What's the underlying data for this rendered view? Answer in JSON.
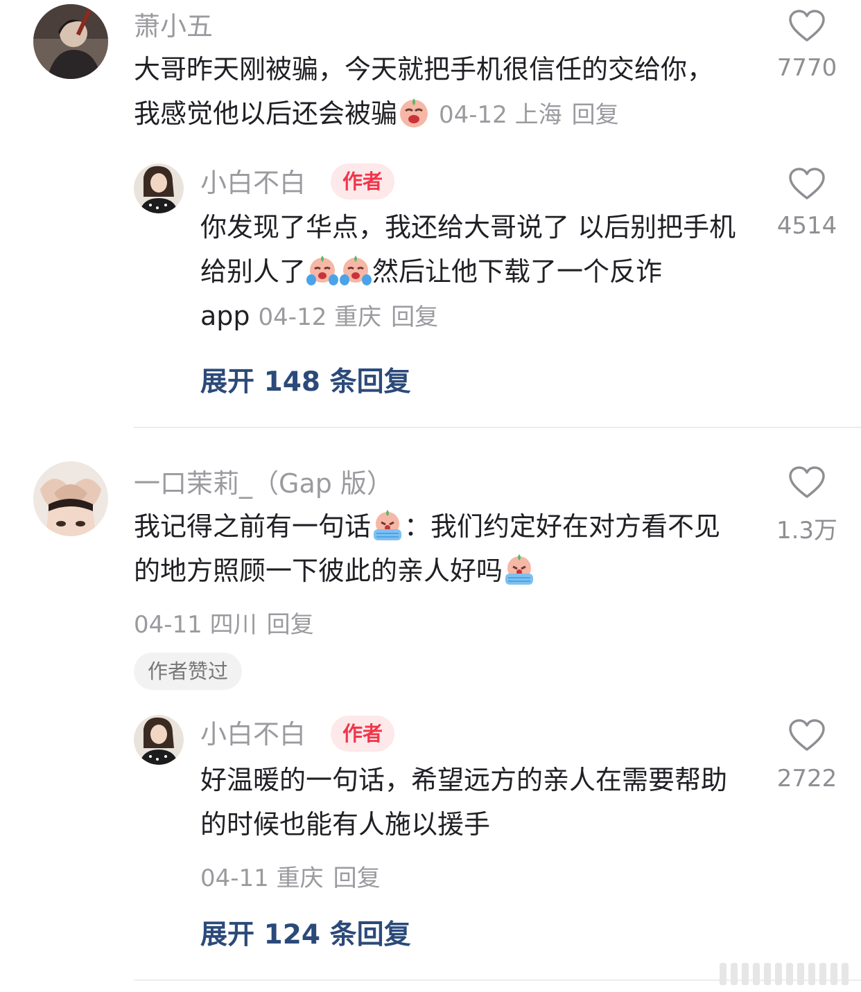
{
  "comments": [
    {
      "username": "萧小五",
      "text": "大哥昨天刚被骗，今天就把手机很信任的交给你，我感觉他以后还会被骗",
      "date": "04-12",
      "location": "上海",
      "reply_label": "回复",
      "likes": "7770",
      "author_reply": {
        "username": "小白不白",
        "badge": "作者",
        "text_a": "你发现了华点，我还给大哥说了 以后别把手机给别人了",
        "text_b": "然后让他下载了一个反诈 app",
        "date": "04-12",
        "location": "重庆",
        "reply_label": "回复",
        "likes": "4514"
      },
      "expand_label": "展开 148 条回复"
    },
    {
      "username": "一口茉莉_（Gap 版）",
      "text_a": "我记得之前有一句话",
      "text_b": "：我们约定好在对方看不见的地方照顾一下彼此的亲人好吗",
      "date": "04-11",
      "location": "四川",
      "reply_label": "回复",
      "liked_by_author": "作者赞过",
      "likes": "1.3万",
      "author_reply": {
        "username": "小白不白",
        "badge": "作者",
        "text": "好温暖的一句话，希望远方的亲人在需要帮助的时候也能有人施以援手",
        "date": "04-11",
        "location": "重庆",
        "reply_label": "回复",
        "likes": "2722"
      },
      "expand_label": "展开 124 条回复"
    }
  ],
  "icons": {
    "like": "heart-outline-icon",
    "emoji_sad": "crying-face-emoji",
    "emoji_tears": "tears-face-emoji",
    "emoji_hug": "crying-hug-emoji"
  },
  "colors": {
    "author_badge_bg": "#fde8ea",
    "author_badge_text": "#f0364b",
    "expand_link": "#2b4a7a",
    "meta_gray": "#9a9a9f"
  }
}
